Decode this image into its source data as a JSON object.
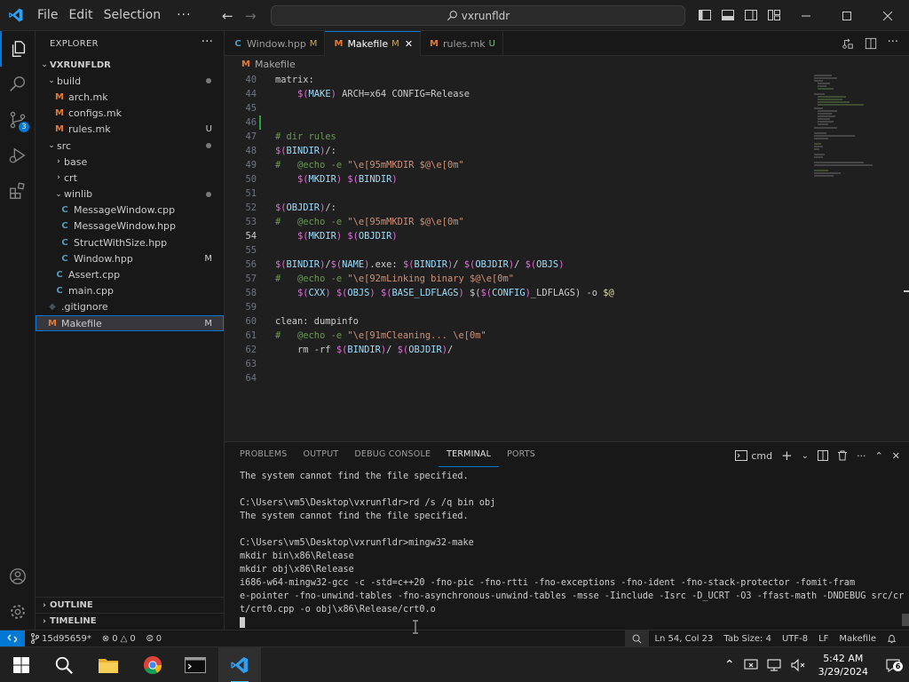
{
  "titlebar": {
    "menus": [
      "File",
      "Edit",
      "Selection"
    ],
    "more": "···",
    "search_text": "vxrunfldr"
  },
  "activity": {
    "source_control_badge": "3"
  },
  "sidebar": {
    "title": "EXPLORER",
    "more": "···",
    "root": "VXRUNFLDR",
    "items": [
      {
        "label": "build",
        "status": ""
      },
      {
        "label": "arch.mk",
        "status": ""
      },
      {
        "label": "configs.mk",
        "status": ""
      },
      {
        "label": "rules.mk",
        "status": "U"
      },
      {
        "label": "src",
        "status": ""
      },
      {
        "label": "base",
        "status": ""
      },
      {
        "label": "crt",
        "status": ""
      },
      {
        "label": "winlib",
        "status": ""
      },
      {
        "label": "MessageWindow.cpp",
        "status": ""
      },
      {
        "label": "MessageWindow.hpp",
        "status": ""
      },
      {
        "label": "StructWithSize.hpp",
        "status": ""
      },
      {
        "label": "Window.hpp",
        "status": "M"
      },
      {
        "label": "Assert.cpp",
        "status": ""
      },
      {
        "label": "main.cpp",
        "status": ""
      },
      {
        "label": ".gitignore",
        "status": ""
      },
      {
        "label": "Makefile",
        "status": "M"
      }
    ],
    "outline": "OUTLINE",
    "timeline": "TIMELINE"
  },
  "tabs": [
    {
      "label": "Window.hpp",
      "state": "M",
      "icon": "C"
    },
    {
      "label": "Makefile",
      "state": "M",
      "icon": "M"
    },
    {
      "label": "rules.mk",
      "state": "U",
      "icon": "M"
    }
  ],
  "breadcrumb": "Makefile",
  "editor": {
    "lines": [
      {
        "n": "40",
        "t": "matrix:"
      },
      {
        "n": "44",
        "t": "    $(MAKE) ARCH=x64 CONFIG=Release"
      },
      {
        "n": "45",
        "t": ""
      },
      {
        "n": "46",
        "t": ""
      },
      {
        "n": "47",
        "t": "# dir rules"
      },
      {
        "n": "48",
        "t": "$(BINDIR)/:"
      },
      {
        "n": "49",
        "t": "#   @echo -e \"\\e[95mMKDIR $@\\e[0m\""
      },
      {
        "n": "50",
        "t": "    $(MKDIR) $(BINDIR)"
      },
      {
        "n": "51",
        "t": ""
      },
      {
        "n": "52",
        "t": "$(OBJDIR)/:"
      },
      {
        "n": "53",
        "t": "#   @echo -e \"\\e[95mMKDIR $@\\e[0m\""
      },
      {
        "n": "54",
        "t": "    $(MKDIR) $(OBJDIR)"
      },
      {
        "n": "55",
        "t": ""
      },
      {
        "n": "56",
        "t": "$(BINDIR)/$(NAME).exe: $(BINDIR)/ $(OBJDIR)/ $(OBJS)"
      },
      {
        "n": "57",
        "t": "#   @echo -e \"\\e[92mLinking binary $@\\e[0m\""
      },
      {
        "n": "58",
        "t": "    $(CXX) $(OBJS) $(BASE_LDFLAGS) $($(CONFIG)_LDFLAGS) -o $@"
      },
      {
        "n": "59",
        "t": ""
      },
      {
        "n": "60",
        "t": "clean: dumpinfo"
      },
      {
        "n": "61",
        "t": "#   @echo -e \"\\e[91mCleaning... \\e[0m\""
      },
      {
        "n": "62",
        "t": "    rm -rf $(BINDIR)/ $(OBJDIR)/"
      },
      {
        "n": "63",
        "t": ""
      },
      {
        "n": "64",
        "t": ""
      }
    ]
  },
  "panel": {
    "tabs": [
      "PROBLEMS",
      "OUTPUT",
      "DEBUG CONSOLE",
      "TERMINAL",
      "PORTS"
    ],
    "shell": "cmd",
    "terminal_lines": [
      "The system cannot find the file specified.",
      "",
      "C:\\Users\\vm5\\Desktop\\vxrunfldr>rd /s /q bin obj",
      "The system cannot find the file specified.",
      "",
      "C:\\Users\\vm5\\Desktop\\vxrunfldr>mingw32-make",
      "mkdir bin\\x86\\Release",
      "mkdir obj\\x86\\Release",
      "i686-w64-mingw32-gcc -c -std=c++20 -fno-pic -fno-rtti -fno-exceptions -fno-ident -fno-stack-protector -fomit-fram",
      "e-pointer -fno-unwind-tables -fno-asynchronous-unwind-tables -msse -Iinclude -Isrc -D_UCRT -O3 -ffast-math -DNDEBUG src/cr",
      "t/crt0.cpp -o obj\\x86\\Release/crt0.o"
    ]
  },
  "status": {
    "branch": "15d95659*",
    "errors": "0",
    "warnings": "0",
    "ports": "0",
    "position": "Ln 54, Col 23",
    "tabsize": "Tab Size: 4",
    "encoding": "UTF-8",
    "eol": "LF",
    "language": "Makefile"
  },
  "taskbar": {
    "time": "5:42 AM",
    "date": "3/29/2024",
    "notifications": "6"
  }
}
